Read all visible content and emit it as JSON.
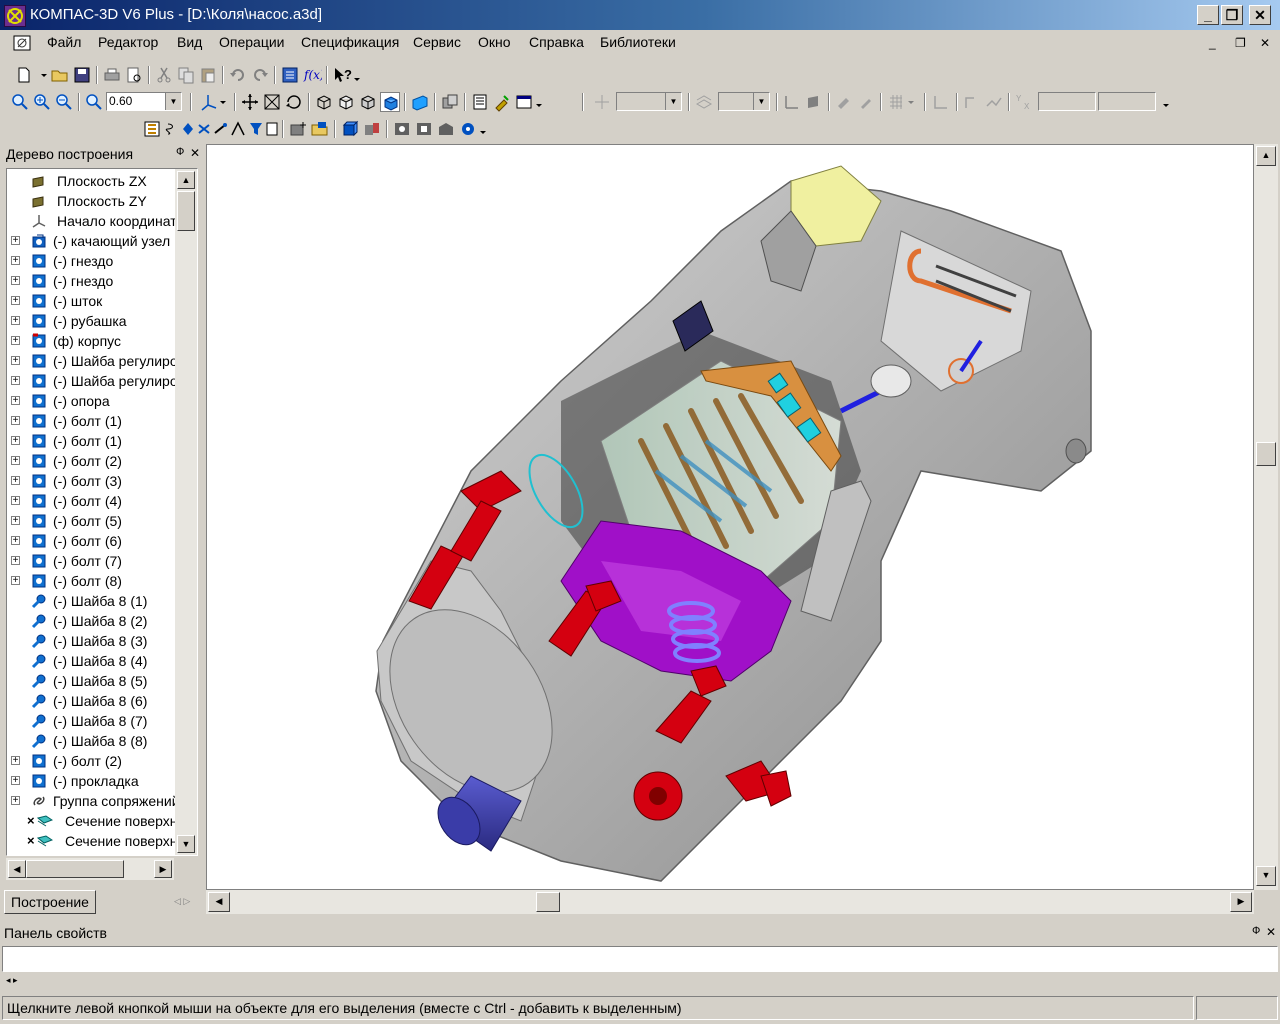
{
  "window": {
    "title": "КОМПАС-3D V6 Plus - [D:\\Коля\\насос.a3d]",
    "minimize": "_",
    "maximize": "❐",
    "close": "✕"
  },
  "menu": {
    "items": [
      "Файл",
      "Редактор",
      "Вид",
      "Операции",
      "Спецификация",
      "Сервис",
      "Окно",
      "Справка",
      "Библиотеки"
    ],
    "mdi_minimize": "_",
    "mdi_restore": "❐",
    "mdi_close": "✕"
  },
  "toolbar": {
    "zoom_value": "0.60"
  },
  "tree": {
    "title": "Дерево построения",
    "pin": "Ф",
    "close": "✕",
    "tab": "Построение",
    "items": [
      {
        "label": "Плоскость ZX",
        "icon": "plane-icon",
        "expand": false
      },
      {
        "label": "Плоскость ZY",
        "icon": "plane-icon",
        "expand": false
      },
      {
        "label": "Начало координат",
        "icon": "origin-icon",
        "expand": false
      },
      {
        "label": "(-) качающий узел",
        "icon": "subassembly-icon",
        "expand": true
      },
      {
        "label": "(-) гнездо",
        "icon": "part-icon",
        "expand": true
      },
      {
        "label": "(-) гнездо",
        "icon": "part-icon",
        "expand": true
      },
      {
        "label": "(-) шток",
        "icon": "part-icon",
        "expand": true
      },
      {
        "label": "(-) рубашка",
        "icon": "part-icon",
        "expand": true
      },
      {
        "label": "(ф) корпус",
        "icon": "fixed-part-icon",
        "expand": true
      },
      {
        "label": "(-) Шайба регулировочная",
        "icon": "part-icon",
        "expand": true
      },
      {
        "label": "(-) Шайба регулировочная",
        "icon": "part-icon",
        "expand": true
      },
      {
        "label": "(-) опора",
        "icon": "part-icon",
        "expand": true
      },
      {
        "label": "(-) болт (1)",
        "icon": "part-icon",
        "expand": true
      },
      {
        "label": "(-) болт (1)",
        "icon": "part-icon",
        "expand": true
      },
      {
        "label": "(-) болт (2)",
        "icon": "part-icon",
        "expand": true
      },
      {
        "label": "(-) болт (3)",
        "icon": "part-icon",
        "expand": true
      },
      {
        "label": "(-) болт (4)",
        "icon": "part-icon",
        "expand": true
      },
      {
        "label": "(-) болт (5)",
        "icon": "part-icon",
        "expand": true
      },
      {
        "label": "(-) болт (6)",
        "icon": "part-icon",
        "expand": true
      },
      {
        "label": "(-) болт (7)",
        "icon": "part-icon",
        "expand": true
      },
      {
        "label": "(-) болт (8)",
        "icon": "part-icon",
        "expand": true
      },
      {
        "label": "(-) Шайба 8 (1)",
        "icon": "standard-part-icon",
        "expand": false
      },
      {
        "label": "(-) Шайба 8  (2)",
        "icon": "standard-part-icon",
        "expand": false
      },
      {
        "label": "(-) Шайба 8  (3)",
        "icon": "standard-part-icon",
        "expand": false
      },
      {
        "label": "(-) Шайба 8 (4)",
        "icon": "standard-part-icon",
        "expand": false
      },
      {
        "label": "(-) Шайба 8  (5)",
        "icon": "standard-part-icon",
        "expand": false
      },
      {
        "label": "(-) Шайба 8 (6)",
        "icon": "standard-part-icon",
        "expand": false
      },
      {
        "label": "(-) Шайба 8  (7)",
        "icon": "standard-part-icon",
        "expand": false
      },
      {
        "label": "(-) Шайба 8  (8)",
        "icon": "standard-part-icon",
        "expand": false
      },
      {
        "label": "(-) болт (2)",
        "icon": "part-icon",
        "expand": true
      },
      {
        "label": "(-) прокладка",
        "icon": "part-icon",
        "expand": true
      },
      {
        "label": "Группа сопряжений",
        "icon": "mates-icon",
        "expand": true
      },
      {
        "label": "Сечение поверхностью",
        "icon": "section-icon",
        "expand": false
      },
      {
        "label": "Сечение поверхностью",
        "icon": "section-icon",
        "expand": false
      }
    ]
  },
  "properties": {
    "title": "Панель свойств",
    "pin": "Ф",
    "close": "✕"
  },
  "status": {
    "text": "Щелкните левой кнопкой мыши на объекте для его выделения (вместе с Ctrl - добавить к выделенным)"
  },
  "colors": {
    "titlebar_start": "#0a246a",
    "titlebar_end": "#a6caf0",
    "chrome": "#d4d0c8",
    "housing": "#b4b4b4",
    "bolt": "#d40010",
    "shaft": "#3a3ca8",
    "violet": "#a010c8"
  }
}
